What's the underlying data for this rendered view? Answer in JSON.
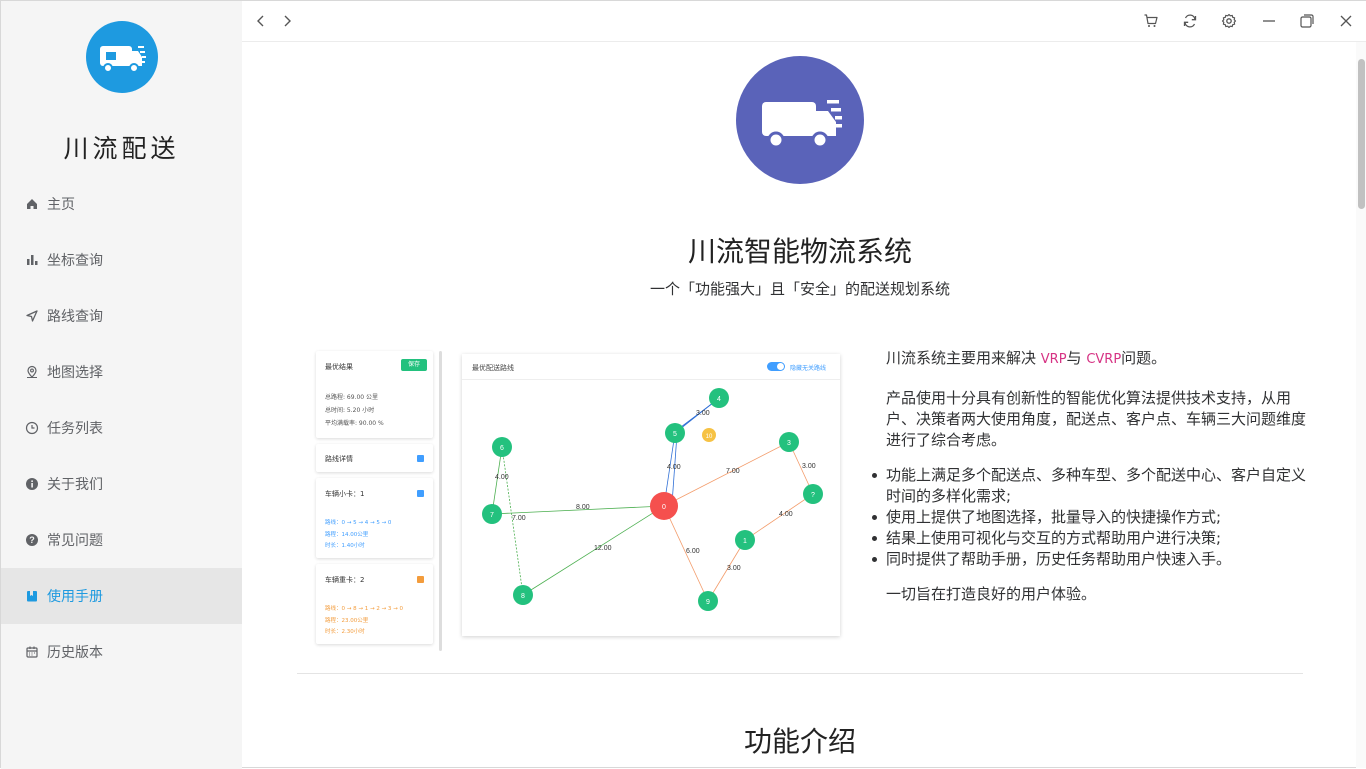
{
  "app": {
    "name": "川流配送"
  },
  "sidebar": {
    "items": [
      {
        "label": "主页",
        "icon": "home-icon"
      },
      {
        "label": "坐标查询",
        "icon": "bar-chart-icon"
      },
      {
        "label": "路线查询",
        "icon": "navigation-icon"
      },
      {
        "label": "地图选择",
        "icon": "map-pin-icon"
      },
      {
        "label": "任务列表",
        "icon": "clock-icon"
      },
      {
        "label": "关于我们",
        "icon": "info-icon"
      },
      {
        "label": "常见问题",
        "icon": "question-icon"
      },
      {
        "label": "使用手册",
        "icon": "book-icon",
        "active": true
      },
      {
        "label": "历史版本",
        "icon": "calendar-icon"
      }
    ]
  },
  "titlebar": {
    "buttons": [
      "back-icon",
      "forward-icon",
      "cart-icon",
      "refresh-icon",
      "settings-icon",
      "minimize-icon",
      "maximize-icon",
      "close-icon"
    ]
  },
  "hero": {
    "title": "川流智能物流系统",
    "subtitle": "一个「功能强大」且「安全」的配送规划系统"
  },
  "preview": {
    "result_title": "最优结果",
    "save_label": "保存",
    "total_distance": "总路程: 69.00 公里",
    "total_time": "总时间: 5.20 小时",
    "load_rate": "平均满载率: 90.00 %",
    "route_details": "路线详情",
    "vehicle1_title": "车辆小卡：1",
    "vehicle1_route": "路线：0 → 5 → 4 → 5 → 0",
    "vehicle1_distance": "路程：14.00公里",
    "vehicle1_time": "时长：1.40小时",
    "vehicle2_title": "车辆重卡：2",
    "vehicle2_route": "路线：0 → 8 → 1 → 2 → 3 → 0",
    "vehicle2_distance": "路程：23.00公里",
    "vehicle2_time": "时长：2.30小时",
    "graph_title": "最优配送路线",
    "toggle_label": "隐藏无关路线",
    "nodes": [
      {
        "id": "0",
        "color": "#f5504e"
      },
      {
        "id": "1",
        "color": "#23c17e"
      },
      {
        "id": "3",
        "color": "#23c17e"
      },
      {
        "id": "4",
        "color": "#23c17e"
      },
      {
        "id": "5",
        "color": "#23c17e"
      },
      {
        "id": "6",
        "color": "#23c17e"
      },
      {
        "id": "7",
        "color": "#23c17e"
      },
      {
        "id": "8",
        "color": "#23c17e"
      },
      {
        "id": "9",
        "color": "#23c17e"
      },
      {
        "id": "?",
        "color": "#23c17e"
      },
      {
        "id": "10",
        "color": "#f6c244"
      }
    ],
    "edge_labels": [
      "3.00",
      "4.00",
      "7.00",
      "3.00",
      "4.00",
      "4.00",
      "7.00",
      "8.00",
      "12.00",
      "6.00",
      "3.00"
    ]
  },
  "description": {
    "intro_prefix": "川流系统主要用来解决 ",
    "tag_vrp": "VRP",
    "intro_mid": "与 ",
    "tag_cvrp": "CVRP",
    "intro_suffix": "问题。",
    "para2": "产品使用十分具有创新性的智能优化算法提供技术支持，从用户、决策者两大使用角度，配送点、客户点、车辆三大问题维度进行了综合考虑。",
    "bullets": [
      "功能上满足多个配送点、多种车型、多个配送中心、客户自定义时间的多样化需求;",
      "使用上提供了地图选择，批量导入的快捷操作方式;",
      "结果上使用可视化与交互的方式帮助用户进行决策;",
      "同时提供了帮助手册，历史任务帮助用户快速入手。"
    ],
    "closing": "一切旨在打造良好的用户体验。"
  },
  "section": {
    "title": "功能介绍"
  },
  "colors": {
    "accent": "#1e9ae0",
    "hero": "#5a63b9",
    "tag": "#d63384"
  }
}
